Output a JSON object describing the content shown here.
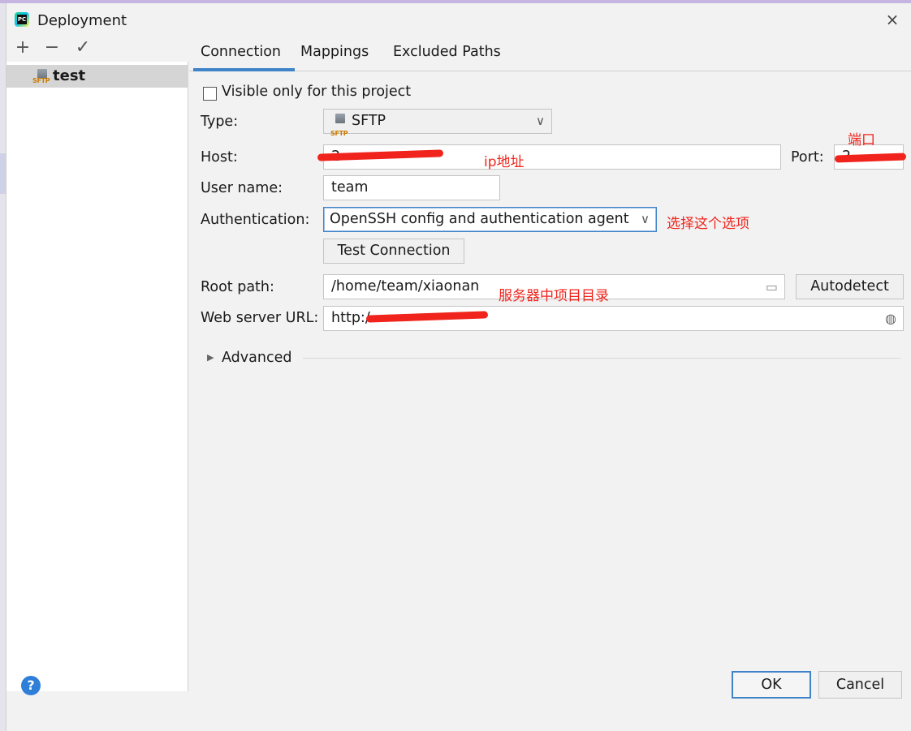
{
  "window": {
    "title": "Deployment",
    "close_label": "×"
  },
  "left_toolbar": {
    "add": "+",
    "remove": "−",
    "apply": "✓"
  },
  "servers": [
    {
      "name": "test",
      "icon_label": "SFTP"
    }
  ],
  "tabs": [
    {
      "label": "Connection",
      "active": true
    },
    {
      "label": "Mappings",
      "active": false
    },
    {
      "label": "Excluded Paths",
      "active": false
    }
  ],
  "connection": {
    "visible_only_label": "Visible only for this project",
    "visible_only_checked": false,
    "type_label": "Type:",
    "type_value": "SFTP",
    "type_icon_label": "SFTP",
    "host_label": "Host:",
    "host_value": "2",
    "port_label": "Port:",
    "port_value": "2",
    "username_label": "User name:",
    "username_value": "team",
    "auth_label": "Authentication:",
    "auth_value": "OpenSSH config and authentication agent",
    "test_connection_label": "Test Connection",
    "root_path_label": "Root path:",
    "root_path_value": "/home/team/xiaonan",
    "autodetect_label": "Autodetect",
    "web_url_label": "Web server URL:",
    "web_url_value": "http:/",
    "advanced_label": "Advanced"
  },
  "annotations": {
    "port_note": "端口",
    "host_note": "ip地址",
    "auth_note": "选择这个选项",
    "root_note": "服务器中项目目录"
  },
  "footer": {
    "help": "?",
    "ok": "OK",
    "cancel": "Cancel"
  },
  "colors": {
    "accent": "#4083c9",
    "annotation": "#f0241c",
    "selection": "#d5d5d5"
  }
}
